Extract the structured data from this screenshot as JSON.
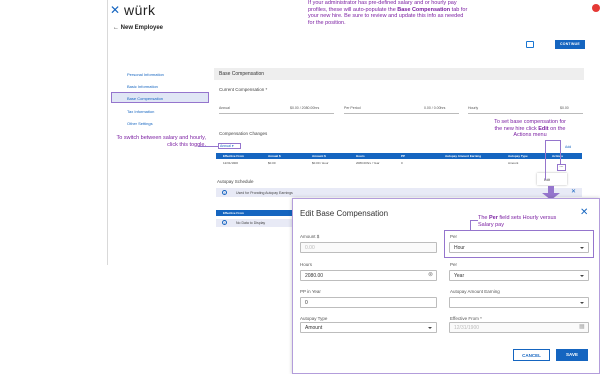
{
  "header": {
    "logo": "würk",
    "back_label": "New Employee",
    "continue_label": "CONTINUE"
  },
  "nav": {
    "items": [
      "Personal Information",
      "Basic Information",
      "Base Compensation",
      "Tax Information",
      "Other Settings"
    ]
  },
  "panel": {
    "title": "Base Compensation",
    "current_comp_label": "Current Compensation *",
    "annual_label": "Annual",
    "annual_value": "$0.00 / 2080.00hrs",
    "pay_period_label": "Per Period",
    "pay_period_value": "0.00 / 0.00hrs",
    "hourly_label": "Hourly",
    "hourly_value": "$0.00",
    "changes_label": "Compensation Changes",
    "toggle_label": "Annual",
    "add_label": "Add",
    "table_headers": [
      "Effective From",
      "Annual $",
      "Amount $",
      "Hours",
      "PP",
      "Autopay Amount Earning",
      "Autopay Type",
      "Actions"
    ],
    "table_row": [
      "12/31/1900",
      "$0.00",
      "$0.00 / Hour",
      "2080.00hrs / Year",
      "0",
      "",
      "Amount",
      "..."
    ],
    "edit_menu_label": "Edit",
    "autopay_title": "Autopay Schedule",
    "autopay_banner": "Used for Prorating Autopay Earnings",
    "table2_header": "Effective From",
    "no_data": "No Data to Display"
  },
  "tips": {
    "top_text": "If your administrator has pre-defined salary and or hourly pay profiles, these will auto-populate the Base Compensation tab for your new hire. Be sure to review and update this info as needed for the position.",
    "top_pre": "If your administrator has pre-defined salary and or hourly pay profiles, these will auto-populate the ",
    "top_bold": "Base Compensation",
    "top_post": " tab for your new hire. Be sure to review and update this info as needed for the position.",
    "left_text": "To switch between salary and hourly, click this toggle.",
    "right_pre": "To set base compensation for the new hire click ",
    "right_bold": "Edit",
    "right_post": " on the Actions menu",
    "per_pre": "The ",
    "per_bold": "Per",
    "per_post": " field sets Hourly versus Salary pay"
  },
  "modal": {
    "title": "Edit Base Compensation",
    "amount_label": "Amount $",
    "amount_value": "0.00",
    "per_label": "Per",
    "per_value": "Hour",
    "hours_label": "Hours",
    "hours_value": "2080.00",
    "per2_label": "Per",
    "per2_value": "Year",
    "pp_label": "PP in Year",
    "pp_value": "0",
    "autopay_earning_label": "Autopay Amount Earning",
    "autopay_earning_value": "",
    "autopay_type_label": "Autopay Type",
    "autopay_type_value": "Amount",
    "effective_label": "Effective From *",
    "effective_value": "12/31/1900",
    "cancel_label": "CANCEL",
    "save_label": "SAVE"
  },
  "colors": {
    "brand": "#1565c0",
    "highlight": "#9575cd",
    "tip_text": "#7b1fa2"
  }
}
